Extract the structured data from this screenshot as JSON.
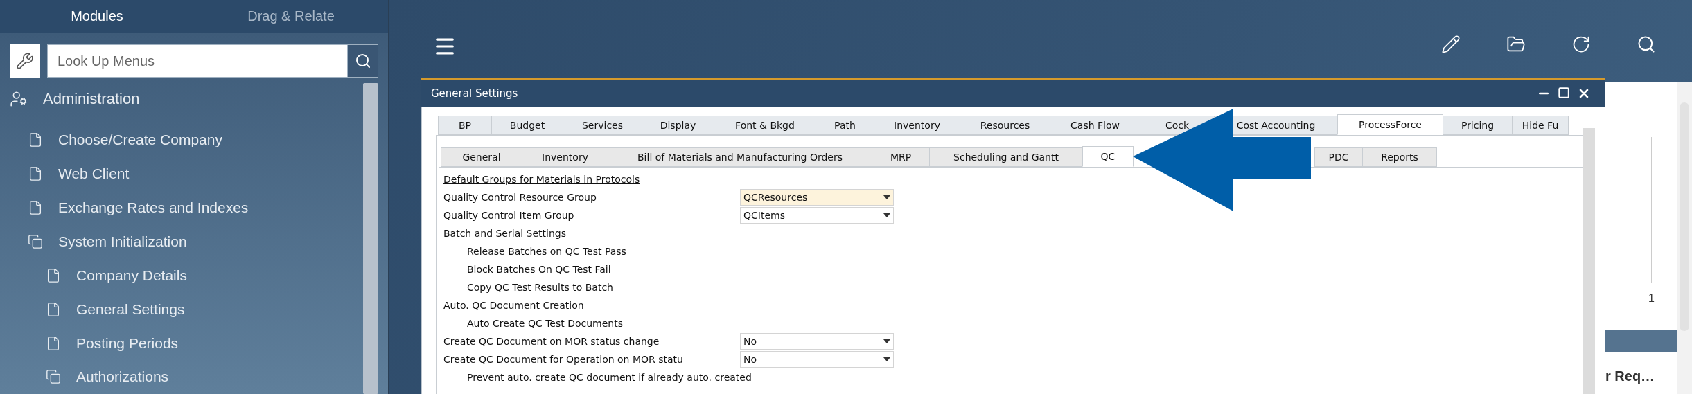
{
  "sidebar": {
    "tabs": [
      {
        "label": "Modules",
        "selected": true
      },
      {
        "label": "Drag & Relate",
        "selected": false
      }
    ],
    "search": {
      "placeholder": "Look Up Menus"
    },
    "tree": [
      {
        "label": "Administration",
        "kind": "module",
        "children": [
          {
            "label": "Choose/Create Company",
            "kind": "page"
          },
          {
            "label": "Web Client",
            "kind": "page"
          },
          {
            "label": "Exchange Rates and Indexes",
            "kind": "page"
          },
          {
            "label": "System Initialization",
            "kind": "folder",
            "children": [
              {
                "label": "Company Details",
                "kind": "page"
              },
              {
                "label": "General Settings",
                "kind": "page"
              },
              {
                "label": "Posting Periods",
                "kind": "page"
              },
              {
                "label": "Authorizations",
                "kind": "folder"
              }
            ]
          }
        ]
      }
    ]
  },
  "dialog": {
    "title": "General Settings",
    "tabs": [
      {
        "label": "BP",
        "selected": false
      },
      {
        "label": "Budget",
        "selected": false
      },
      {
        "label": "Services",
        "selected": false
      },
      {
        "label": "Display",
        "selected": false
      },
      {
        "label": "Font & Bkgd",
        "selected": false
      },
      {
        "label": "Path",
        "selected": false
      },
      {
        "label": "Inventory",
        "selected": false
      },
      {
        "label": "Resources",
        "selected": false
      },
      {
        "label": "Cash Flow",
        "selected": false
      },
      {
        "label": "Cock",
        "selected": false
      },
      {
        "label": "Cost Accounting",
        "selected": false
      },
      {
        "label": "ProcessForce",
        "selected": true
      },
      {
        "label": "Pricing",
        "selected": false
      },
      {
        "label": "Hide Fu",
        "selected": false
      }
    ],
    "subtabs": [
      {
        "label": "General",
        "selected": false
      },
      {
        "label": "Inventory",
        "selected": false
      },
      {
        "label": "Bill of Materials and Manufacturing Orders",
        "selected": false
      },
      {
        "label": "MRP",
        "selected": false
      },
      {
        "label": "Scheduling and Gantt",
        "selected": false
      },
      {
        "label": "QC",
        "selected": true
      },
      {
        "label": "PDC",
        "selected": false
      },
      {
        "label": "Reports",
        "selected": false
      }
    ],
    "rows": [
      {
        "kind": "heading",
        "label": "Default Groups for Materials in Protocols"
      },
      {
        "kind": "dropdown",
        "label": "Quality Control Resource Group",
        "value": "QCResources",
        "focused": true
      },
      {
        "kind": "dropdown",
        "label": "Quality Control Item Group",
        "value": "QCItems",
        "focused": false
      },
      {
        "kind": "heading",
        "label": "Batch and Serial Settings"
      },
      {
        "kind": "checkbox",
        "label": "Release Batches on QC Test Pass",
        "checked": false
      },
      {
        "kind": "checkbox",
        "label": "Block Batches On QC Test Fail",
        "checked": false
      },
      {
        "kind": "checkbox",
        "label": "Copy QC Test Results to Batch",
        "checked": false
      },
      {
        "kind": "heading",
        "label": "Auto. QC Document Creation"
      },
      {
        "kind": "checkbox",
        "label": "Auto Create QC Test Documents",
        "checked": false
      },
      {
        "kind": "dropdown",
        "label": "Create QC Document on MOR status change",
        "value": "No",
        "focused": false
      },
      {
        "kind": "dropdown",
        "label": "Create QC Document for Operation on MOR statu",
        "value": "No",
        "focused": false
      },
      {
        "kind": "checkbox",
        "label": "Prevent auto. create QC document if already auto. created",
        "checked": false
      }
    ]
  },
  "right_panel": {
    "value": "1",
    "heading": "r Req…"
  }
}
